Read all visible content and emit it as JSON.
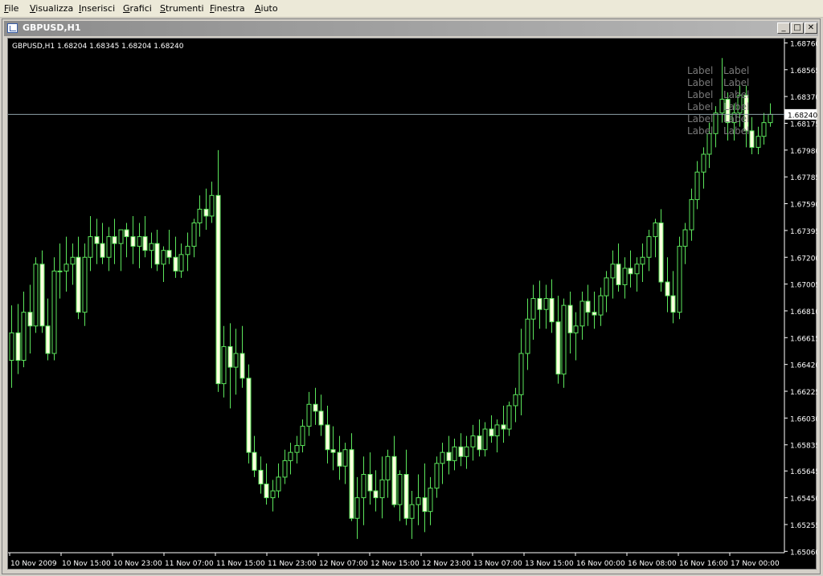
{
  "menu": [
    "File",
    "Visualizza",
    "Inserisci",
    "Grafici",
    "Strumenti",
    "Finestra",
    "Aiuto"
  ],
  "window": {
    "title": "GBPUSD,H1",
    "buttons": [
      "_",
      "□",
      "✕"
    ]
  },
  "chart": {
    "info_text": "GBPUSD,H1  1.68204 1.68345 1.68204 1.68240",
    "current_price_label": "1.68240",
    "label_text": "Label"
  },
  "colors": {
    "background": "#000000",
    "candle": "#5ce65c",
    "bull_body": "#000000",
    "bear_body": "#ffffe0",
    "grid_text": "#ffffff",
    "price_line": "#8ea0a8",
    "label_text": "#7a7a7a"
  },
  "chart_data": {
    "type": "candlestick",
    "symbol": "GBPUSD",
    "timeframe": "H1",
    "y_ticks": [
      "1.68760",
      "1.68565",
      "1.68370",
      "1.68175",
      "1.67980",
      "1.67785",
      "1.67590",
      "1.67395",
      "1.67200",
      "1.67005",
      "1.66810",
      "1.66615",
      "1.66420",
      "1.66225",
      "1.66030",
      "1.65835",
      "1.65645",
      "1.65450",
      "1.65255",
      "1.65060"
    ],
    "x_ticks": [
      "10 Nov 2009",
      "10 Nov 15:00",
      "10 Nov 23:00",
      "11 Nov 07:00",
      "11 Nov 15:00",
      "11 Nov 23:00",
      "12 Nov 07:00",
      "12 Nov 15:00",
      "12 Nov 23:00",
      "13 Nov 07:00",
      "13 Nov 15:00",
      "16 Nov 00:00",
      "16 Nov 08:00",
      "16 Nov 16:00",
      "17 Nov 00:00"
    ],
    "ylim": [
      1.6505,
      1.6878
    ],
    "current_price": 1.6824,
    "candles": [
      [
        1.6645,
        1.6685,
        1.6625,
        1.6665
      ],
      [
        1.6665,
        1.6686,
        1.6635,
        1.6645
      ],
      [
        1.6645,
        1.6695,
        1.664,
        1.668
      ],
      [
        1.668,
        1.67,
        1.665,
        1.667
      ],
      [
        1.667,
        1.672,
        1.6665,
        1.6715
      ],
      [
        1.6715,
        1.6725,
        1.6665,
        1.667
      ],
      [
        1.667,
        1.669,
        1.6645,
        1.665
      ],
      [
        1.665,
        1.672,
        1.6645,
        1.671
      ],
      [
        1.671,
        1.673,
        1.669,
        1.671
      ],
      [
        1.671,
        1.6735,
        1.6695,
        1.6715
      ],
      [
        1.6715,
        1.673,
        1.67,
        1.672
      ],
      [
        1.672,
        1.6735,
        1.6675,
        1.668
      ],
      [
        1.668,
        1.673,
        1.667,
        1.672
      ],
      [
        1.672,
        1.675,
        1.671,
        1.6735
      ],
      [
        1.6735,
        1.6748,
        1.6715,
        1.673
      ],
      [
        1.673,
        1.6745,
        1.6715,
        1.672
      ],
      [
        1.672,
        1.6742,
        1.671,
        1.6735
      ],
      [
        1.6735,
        1.6748,
        1.6715,
        1.673
      ],
      [
        1.673,
        1.674,
        1.671,
        1.674
      ],
      [
        1.674,
        1.6745,
        1.672,
        1.6735
      ],
      [
        1.6735,
        1.675,
        1.6715,
        1.6728
      ],
      [
        1.6728,
        1.6745,
        1.6712,
        1.6735
      ],
      [
        1.6735,
        1.675,
        1.672,
        1.6725
      ],
      [
        1.6725,
        1.6738,
        1.6712,
        1.673
      ],
      [
        1.673,
        1.674,
        1.671,
        1.6715
      ],
      [
        1.6715,
        1.6728,
        1.6702,
        1.6725
      ],
      [
        1.6725,
        1.674,
        1.6715,
        1.672
      ],
      [
        1.672,
        1.6735,
        1.6705,
        1.671
      ],
      [
        1.671,
        1.673,
        1.6705,
        1.6722
      ],
      [
        1.6722,
        1.6738,
        1.671,
        1.6728
      ],
      [
        1.6728,
        1.6748,
        1.672,
        1.6745
      ],
      [
        1.6745,
        1.6765,
        1.6735,
        1.6755
      ],
      [
        1.6755,
        1.677,
        1.674,
        1.675
      ],
      [
        1.675,
        1.6775,
        1.6745,
        1.6765
      ],
      [
        1.6765,
        1.6798,
        1.6622,
        1.6628
      ],
      [
        1.6628,
        1.667,
        1.6618,
        1.6655
      ],
      [
        1.6655,
        1.6672,
        1.661,
        1.664
      ],
      [
        1.664,
        1.6668,
        1.662,
        1.665
      ],
      [
        1.665,
        1.667,
        1.6625,
        1.6632
      ],
      [
        1.6632,
        1.6642,
        1.657,
        1.6578
      ],
      [
        1.6578,
        1.659,
        1.656,
        1.6565
      ],
      [
        1.6565,
        1.6575,
        1.6548,
        1.6555
      ],
      [
        1.6555,
        1.657,
        1.654,
        1.6545
      ],
      [
        1.6545,
        1.6558,
        1.6535,
        1.655
      ],
      [
        1.655,
        1.657,
        1.6545,
        1.656
      ],
      [
        1.656,
        1.658,
        1.6555,
        1.6572
      ],
      [
        1.6572,
        1.6585,
        1.6562,
        1.6578
      ],
      [
        1.6578,
        1.659,
        1.657,
        1.6583
      ],
      [
        1.6583,
        1.6602,
        1.6578,
        1.6597
      ],
      [
        1.6597,
        1.6622,
        1.659,
        1.6613
      ],
      [
        1.6613,
        1.6625,
        1.6598,
        1.6608
      ],
      [
        1.6608,
        1.662,
        1.659,
        1.6598
      ],
      [
        1.6598,
        1.6612,
        1.657,
        1.658
      ],
      [
        1.658,
        1.6597,
        1.6565,
        1.6578
      ],
      [
        1.6578,
        1.659,
        1.6558,
        1.6568
      ],
      [
        1.6568,
        1.6585,
        1.6555,
        1.658
      ],
      [
        1.658,
        1.6592,
        1.6528,
        1.653
      ],
      [
        1.653,
        1.656,
        1.6515,
        1.6545
      ],
      [
        1.6545,
        1.6575,
        1.6525,
        1.6562
      ],
      [
        1.6562,
        1.6578,
        1.654,
        1.655
      ],
      [
        1.655,
        1.6565,
        1.6535,
        1.6545
      ],
      [
        1.6545,
        1.6575,
        1.653,
        1.6558
      ],
      [
        1.6558,
        1.658,
        1.6545,
        1.6575
      ],
      [
        1.6575,
        1.659,
        1.6538,
        1.654
      ],
      [
        1.654,
        1.6565,
        1.6528,
        1.6562
      ],
      [
        1.6562,
        1.658,
        1.6525,
        1.653
      ],
      [
        1.653,
        1.655,
        1.6515,
        1.654
      ],
      [
        1.654,
        1.6562,
        1.6525,
        1.6545
      ],
      [
        1.6545,
        1.657,
        1.652,
        1.6535
      ],
      [
        1.6535,
        1.656,
        1.6525,
        1.6552
      ],
      [
        1.6552,
        1.6575,
        1.6545,
        1.657
      ],
      [
        1.657,
        1.6585,
        1.6555,
        1.6578
      ],
      [
        1.6578,
        1.659,
        1.6562,
        1.6572
      ],
      [
        1.6572,
        1.6588,
        1.6565,
        1.6582
      ],
      [
        1.6582,
        1.6592,
        1.6568,
        1.6575
      ],
      [
        1.6575,
        1.659,
        1.6566,
        1.6582
      ],
      [
        1.6582,
        1.6598,
        1.6572,
        1.659
      ],
      [
        1.659,
        1.6602,
        1.6575,
        1.658
      ],
      [
        1.658,
        1.66,
        1.6575,
        1.6595
      ],
      [
        1.6595,
        1.6605,
        1.6585,
        1.659
      ],
      [
        1.659,
        1.6602,
        1.6578,
        1.6598
      ],
      [
        1.6598,
        1.6612,
        1.6585,
        1.6595
      ],
      [
        1.6595,
        1.6615,
        1.659,
        1.6612
      ],
      [
        1.6612,
        1.6625,
        1.66,
        1.662
      ],
      [
        1.662,
        1.6668,
        1.6605,
        1.665
      ],
      [
        1.665,
        1.669,
        1.6638,
        1.6675
      ],
      [
        1.6675,
        1.67,
        1.666,
        1.669
      ],
      [
        1.669,
        1.6703,
        1.6668,
        1.6682
      ],
      [
        1.6682,
        1.67,
        1.6668,
        1.669
      ],
      [
        1.669,
        1.6704,
        1.6665,
        1.6673
      ],
      [
        1.6673,
        1.6692,
        1.6628,
        1.6635
      ],
      [
        1.6635,
        1.669,
        1.6625,
        1.6685
      ],
      [
        1.6685,
        1.6695,
        1.665,
        1.6665
      ],
      [
        1.6665,
        1.668,
        1.6645,
        1.667
      ],
      [
        1.667,
        1.6695,
        1.666,
        1.6688
      ],
      [
        1.6688,
        1.67,
        1.667,
        1.668
      ],
      [
        1.668,
        1.6695,
        1.6668,
        1.6678
      ],
      [
        1.6678,
        1.6698,
        1.667,
        1.6692
      ],
      [
        1.6692,
        1.671,
        1.668,
        1.6705
      ],
      [
        1.6705,
        1.6725,
        1.669,
        1.6715
      ],
      [
        1.6715,
        1.673,
        1.6695,
        1.67
      ],
      [
        1.67,
        1.672,
        1.669,
        1.6712
      ],
      [
        1.6712,
        1.6725,
        1.6698,
        1.6708
      ],
      [
        1.6708,
        1.672,
        1.6695,
        1.6715
      ],
      [
        1.6715,
        1.673,
        1.6702,
        1.672
      ],
      [
        1.672,
        1.674,
        1.671,
        1.6735
      ],
      [
        1.6735,
        1.6748,
        1.672,
        1.6745
      ],
      [
        1.6745,
        1.6755,
        1.6695,
        1.6702
      ],
      [
        1.6702,
        1.672,
        1.668,
        1.6692
      ],
      [
        1.6692,
        1.671,
        1.6672,
        1.668
      ],
      [
        1.668,
        1.6735,
        1.6675,
        1.6728
      ],
      [
        1.6728,
        1.6745,
        1.6715,
        1.674
      ],
      [
        1.674,
        1.677,
        1.6732,
        1.6762
      ],
      [
        1.6762,
        1.679,
        1.6755,
        1.6782
      ],
      [
        1.6782,
        1.68,
        1.677,
        1.6795
      ],
      [
        1.6795,
        1.6818,
        1.6785,
        1.681
      ],
      [
        1.681,
        1.683,
        1.68,
        1.6825
      ],
      [
        1.6825,
        1.6865,
        1.6818,
        1.6835
      ],
      [
        1.6835,
        1.684,
        1.6805,
        1.6818
      ],
      [
        1.6818,
        1.6832,
        1.6805,
        1.6825
      ],
      [
        1.6825,
        1.6845,
        1.6815,
        1.6838
      ],
      [
        1.6838,
        1.6845,
        1.68,
        1.6812
      ],
      [
        1.6812,
        1.6822,
        1.6795,
        1.68
      ],
      [
        1.68,
        1.6815,
        1.6795,
        1.6808
      ],
      [
        1.6808,
        1.6825,
        1.6802,
        1.6818
      ],
      [
        1.6818,
        1.6832,
        1.6815,
        1.6824
      ]
    ],
    "labels_grid": {
      "rows": 6,
      "cols": 2
    }
  }
}
